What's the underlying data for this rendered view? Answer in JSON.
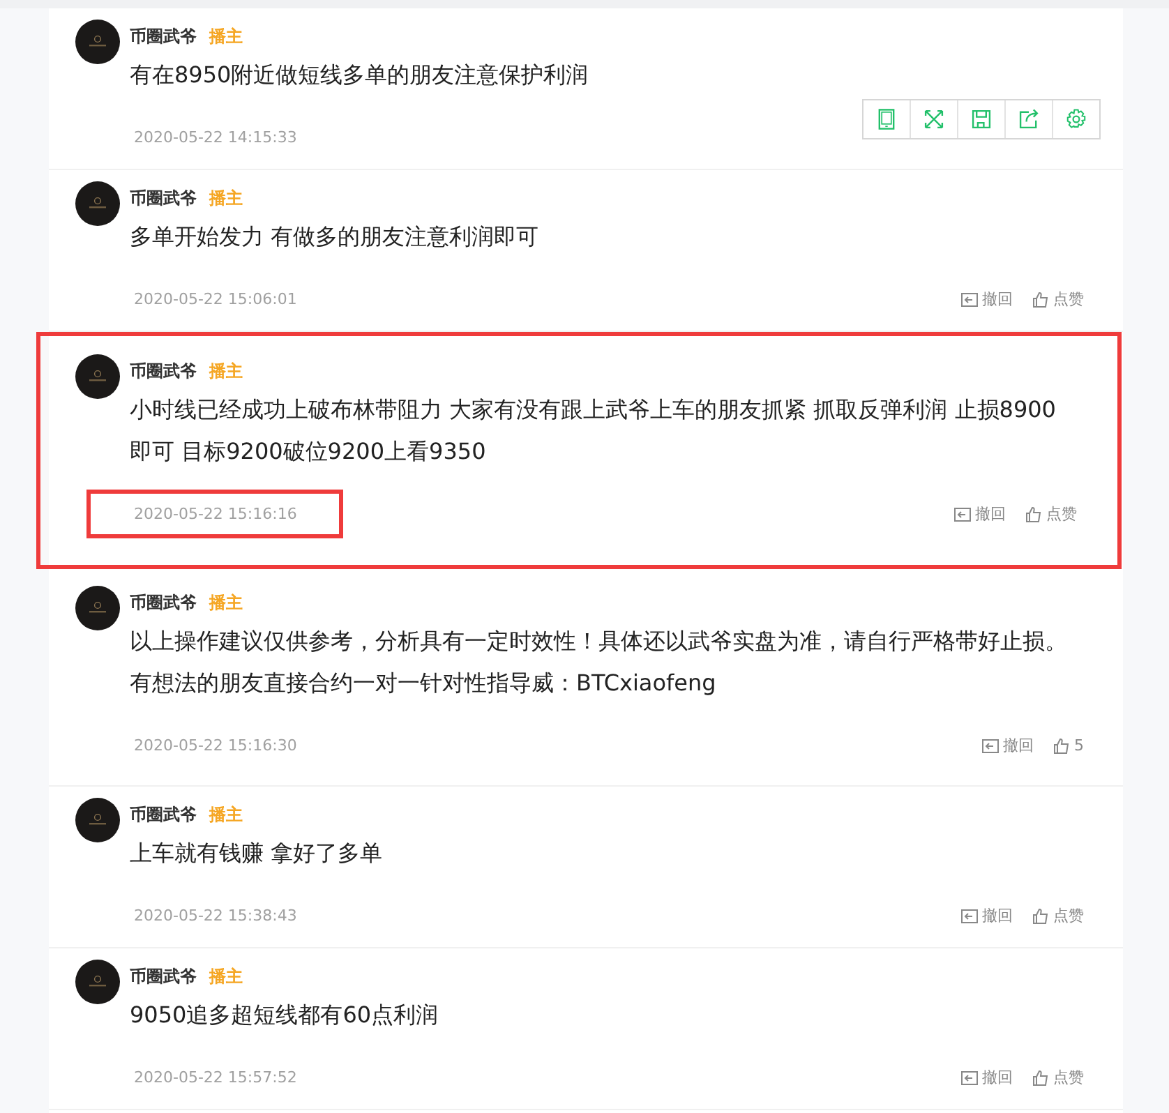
{
  "comments": [
    {
      "author": "币圈武爷",
      "badge": "播主",
      "text": "有在8950附近做短线多单的朋友注意保护利润",
      "time": "2020-05-22 14:15:33",
      "highlighted": false,
      "time_highlighted": false
    },
    {
      "author": "币圈武爷",
      "badge": "播主",
      "text": "多单开始发力 有做多的朋友注意利润即可",
      "time": "2020-05-22 15:06:01",
      "revoke": "撤回",
      "like": "点赞",
      "highlighted": false,
      "time_highlighted": false
    },
    {
      "author": "币圈武爷",
      "badge": "播主",
      "text": "小时线已经成功上破布林带阻力 大家有没有跟上武爷上车的朋友抓紧 抓取反弹利润 止损8900即可 目标9200破位9200上看9350",
      "time": "2020-05-22 15:16:16",
      "revoke": "撤回",
      "like": "点赞",
      "highlighted": true,
      "time_highlighted": true
    },
    {
      "author": "币圈武爷",
      "badge": "播主",
      "text": "以上操作建议仅供参考，分析具有一定时效性！具体还以武爷实盘为准，请自行严格带好止损。有想法的朋友直接合约一对一针对性指导威：BTCxiaofeng",
      "time": "2020-05-22 15:16:30",
      "revoke": "撤回",
      "like": "5",
      "highlighted": false,
      "time_highlighted": false
    },
    {
      "author": "币圈武爷",
      "badge": "播主",
      "text": "上车就有钱赚 拿好了多单",
      "time": "2020-05-22 15:38:43",
      "revoke": "撤回",
      "like": "点赞",
      "highlighted": false,
      "time_highlighted": false
    },
    {
      "author": "币圈武爷",
      "badge": "播主",
      "text": "9050追多超短线都有60点利润",
      "time": "2020-05-22 15:57:52",
      "revoke": "撤回",
      "like": "点赞",
      "highlighted": false,
      "time_highlighted": false
    }
  ],
  "toolbar": [
    {
      "kind": "tablet"
    },
    {
      "kind": "expand"
    },
    {
      "kind": "save"
    },
    {
      "kind": "share"
    },
    {
      "kind": "settings"
    }
  ]
}
